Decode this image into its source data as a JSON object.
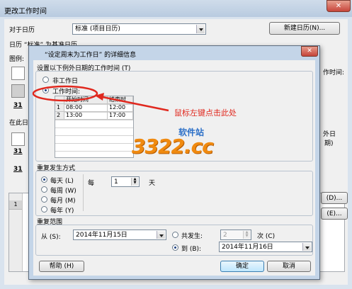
{
  "outer": {
    "title": "更改工作时间",
    "calendar_for_label": "对于日历",
    "calendar_value": "标准 (项目日历)",
    "new_calendar_button": "新建日历(N)...",
    "base_calendar_text": "日历 “标准” 为基准日历。",
    "legend_label": "图例:",
    "day31_a": "31",
    "day31_b": "31",
    "day31_c": "31",
    "on_this_text": "在此日",
    "right_text_a": "作时间:",
    "right_text_b": "外日",
    "right_text_c": "期)",
    "right_btn_a": "(D)...",
    "right_btn_b": "(E)...",
    "row_number": "1"
  },
  "dialog": {
    "title": "“设定周末为工作日” 的详细信息",
    "set_worktime_label": "设置以下例外日期的工作时间 (T)",
    "nonworking_label": "非工作日",
    "working_times_label": "工作时间:",
    "table": {
      "headers": [
        "开始时间",
        "结束时"
      ],
      "rows": [
        {
          "num": "1",
          "start": "08:00",
          "end": "12:00"
        },
        {
          "num": "2",
          "start": "13:00",
          "end": "17:00"
        }
      ]
    },
    "recurrence": {
      "title": "重复发生方式",
      "daily": "每天 (L)",
      "weekly": "每周 (W)",
      "monthly": "每月 (M)",
      "yearly": "每年 (Y)",
      "every_label": "每",
      "every_value": "1",
      "unit_label": "天"
    },
    "range": {
      "title": "重复范围",
      "from_label": "从 (S):",
      "from_value": "2014年11月15日",
      "occurrences_label": "共发生:",
      "occurrences_value": "2",
      "times_label": "次 (C)",
      "to_label": "到 (B):",
      "to_value": "2014年11月16日"
    },
    "help_button": "帮助 (H)",
    "ok_button": "确定",
    "cancel_button": "取消"
  },
  "annotation": {
    "text": "鼠标左键点击此处",
    "color": "#e0281e"
  },
  "watermark": {
    "text": "3322.cc",
    "site_text": "软件站"
  }
}
